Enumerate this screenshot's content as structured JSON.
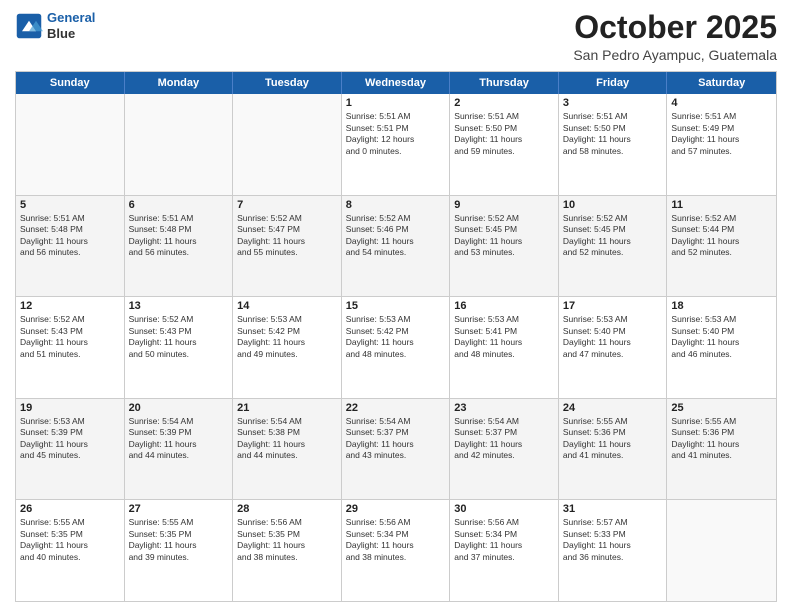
{
  "header": {
    "logo_line1": "General",
    "logo_line2": "Blue",
    "month": "October 2025",
    "location": "San Pedro Ayampuc, Guatemala"
  },
  "dayHeaders": [
    "Sunday",
    "Monday",
    "Tuesday",
    "Wednesday",
    "Thursday",
    "Friday",
    "Saturday"
  ],
  "weeks": [
    [
      {
        "day": "",
        "info": "",
        "empty": true
      },
      {
        "day": "",
        "info": "",
        "empty": true
      },
      {
        "day": "",
        "info": "",
        "empty": true
      },
      {
        "day": "1",
        "info": "Sunrise: 5:51 AM\nSunset: 5:51 PM\nDaylight: 12 hours\nand 0 minutes."
      },
      {
        "day": "2",
        "info": "Sunrise: 5:51 AM\nSunset: 5:50 PM\nDaylight: 11 hours\nand 59 minutes."
      },
      {
        "day": "3",
        "info": "Sunrise: 5:51 AM\nSunset: 5:50 PM\nDaylight: 11 hours\nand 58 minutes."
      },
      {
        "day": "4",
        "info": "Sunrise: 5:51 AM\nSunset: 5:49 PM\nDaylight: 11 hours\nand 57 minutes."
      }
    ],
    [
      {
        "day": "5",
        "info": "Sunrise: 5:51 AM\nSunset: 5:48 PM\nDaylight: 11 hours\nand 56 minutes."
      },
      {
        "day": "6",
        "info": "Sunrise: 5:51 AM\nSunset: 5:48 PM\nDaylight: 11 hours\nand 56 minutes."
      },
      {
        "day": "7",
        "info": "Sunrise: 5:52 AM\nSunset: 5:47 PM\nDaylight: 11 hours\nand 55 minutes."
      },
      {
        "day": "8",
        "info": "Sunrise: 5:52 AM\nSunset: 5:46 PM\nDaylight: 11 hours\nand 54 minutes."
      },
      {
        "day": "9",
        "info": "Sunrise: 5:52 AM\nSunset: 5:45 PM\nDaylight: 11 hours\nand 53 minutes."
      },
      {
        "day": "10",
        "info": "Sunrise: 5:52 AM\nSunset: 5:45 PM\nDaylight: 11 hours\nand 52 minutes."
      },
      {
        "day": "11",
        "info": "Sunrise: 5:52 AM\nSunset: 5:44 PM\nDaylight: 11 hours\nand 52 minutes."
      }
    ],
    [
      {
        "day": "12",
        "info": "Sunrise: 5:52 AM\nSunset: 5:43 PM\nDaylight: 11 hours\nand 51 minutes."
      },
      {
        "day": "13",
        "info": "Sunrise: 5:52 AM\nSunset: 5:43 PM\nDaylight: 11 hours\nand 50 minutes."
      },
      {
        "day": "14",
        "info": "Sunrise: 5:53 AM\nSunset: 5:42 PM\nDaylight: 11 hours\nand 49 minutes."
      },
      {
        "day": "15",
        "info": "Sunrise: 5:53 AM\nSunset: 5:42 PM\nDaylight: 11 hours\nand 48 minutes."
      },
      {
        "day": "16",
        "info": "Sunrise: 5:53 AM\nSunset: 5:41 PM\nDaylight: 11 hours\nand 48 minutes."
      },
      {
        "day": "17",
        "info": "Sunrise: 5:53 AM\nSunset: 5:40 PM\nDaylight: 11 hours\nand 47 minutes."
      },
      {
        "day": "18",
        "info": "Sunrise: 5:53 AM\nSunset: 5:40 PM\nDaylight: 11 hours\nand 46 minutes."
      }
    ],
    [
      {
        "day": "19",
        "info": "Sunrise: 5:53 AM\nSunset: 5:39 PM\nDaylight: 11 hours\nand 45 minutes."
      },
      {
        "day": "20",
        "info": "Sunrise: 5:54 AM\nSunset: 5:39 PM\nDaylight: 11 hours\nand 44 minutes."
      },
      {
        "day": "21",
        "info": "Sunrise: 5:54 AM\nSunset: 5:38 PM\nDaylight: 11 hours\nand 44 minutes."
      },
      {
        "day": "22",
        "info": "Sunrise: 5:54 AM\nSunset: 5:37 PM\nDaylight: 11 hours\nand 43 minutes."
      },
      {
        "day": "23",
        "info": "Sunrise: 5:54 AM\nSunset: 5:37 PM\nDaylight: 11 hours\nand 42 minutes."
      },
      {
        "day": "24",
        "info": "Sunrise: 5:55 AM\nSunset: 5:36 PM\nDaylight: 11 hours\nand 41 minutes."
      },
      {
        "day": "25",
        "info": "Sunrise: 5:55 AM\nSunset: 5:36 PM\nDaylight: 11 hours\nand 41 minutes."
      }
    ],
    [
      {
        "day": "26",
        "info": "Sunrise: 5:55 AM\nSunset: 5:35 PM\nDaylight: 11 hours\nand 40 minutes."
      },
      {
        "day": "27",
        "info": "Sunrise: 5:55 AM\nSunset: 5:35 PM\nDaylight: 11 hours\nand 39 minutes."
      },
      {
        "day": "28",
        "info": "Sunrise: 5:56 AM\nSunset: 5:35 PM\nDaylight: 11 hours\nand 38 minutes."
      },
      {
        "day": "29",
        "info": "Sunrise: 5:56 AM\nSunset: 5:34 PM\nDaylight: 11 hours\nand 38 minutes."
      },
      {
        "day": "30",
        "info": "Sunrise: 5:56 AM\nSunset: 5:34 PM\nDaylight: 11 hours\nand 37 minutes."
      },
      {
        "day": "31",
        "info": "Sunrise: 5:57 AM\nSunset: 5:33 PM\nDaylight: 11 hours\nand 36 minutes."
      },
      {
        "day": "",
        "info": "",
        "empty": true
      }
    ]
  ]
}
